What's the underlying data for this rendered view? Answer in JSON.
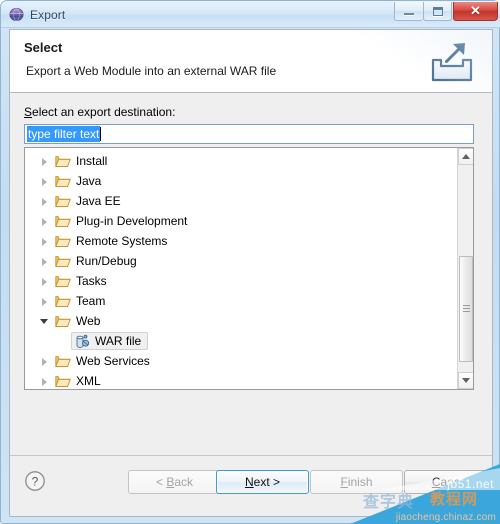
{
  "window": {
    "title": "Export",
    "app_icon": "export-globe-icon",
    "controls": {
      "minimize": "minimize-icon",
      "maximize": "maximize-icon",
      "close": "✕"
    }
  },
  "header": {
    "title": "Select",
    "subtitle": "Export a Web Module into an external WAR file",
    "icon": "export-tray-arrow-icon"
  },
  "body": {
    "field_label_mnemonic": "S",
    "field_label_rest": "elect an export destination:",
    "filter": {
      "value": "type filter text",
      "selected": true
    },
    "tree": [
      {
        "label": "Install",
        "expanded": false,
        "type": "folder",
        "selected": false
      },
      {
        "label": "Java",
        "expanded": false,
        "type": "folder",
        "selected": false
      },
      {
        "label": "Java EE",
        "expanded": false,
        "type": "folder",
        "selected": false
      },
      {
        "label": "Plug-in Development",
        "expanded": false,
        "type": "folder",
        "selected": false
      },
      {
        "label": "Remote Systems",
        "expanded": false,
        "type": "folder",
        "selected": false
      },
      {
        "label": "Run/Debug",
        "expanded": false,
        "type": "folder",
        "selected": false
      },
      {
        "label": "Tasks",
        "expanded": false,
        "type": "folder",
        "selected": false
      },
      {
        "label": "Team",
        "expanded": false,
        "type": "folder",
        "selected": false
      },
      {
        "label": "Web",
        "expanded": true,
        "type": "folder",
        "selected": false
      },
      {
        "label": "WAR file",
        "expanded": null,
        "type": "leaf",
        "selected": true,
        "child": true,
        "icon": "war-file-icon"
      },
      {
        "label": "Web Services",
        "expanded": false,
        "type": "folder",
        "selected": false
      },
      {
        "label": "XML",
        "expanded": false,
        "type": "folder",
        "selected": false
      }
    ]
  },
  "buttons": {
    "help": "?",
    "back": {
      "pre": "< ",
      "mnemonic": "B",
      "post": "ack",
      "enabled": false,
      "default": false
    },
    "next": {
      "pre": "",
      "mnemonic": "N",
      "post": "ext >",
      "enabled": true,
      "default": true
    },
    "finish": {
      "pre": "",
      "mnemonic": "F",
      "post": "inish",
      "enabled": false,
      "default": false
    },
    "cancel": {
      "pre": "",
      "mnemonic": "C",
      "post": "ancel",
      "enabled": true,
      "default": false
    }
  },
  "watermark": {
    "line1": "jb51.net",
    "cn_left": "查字典",
    "cn_right": "教程网",
    "line2": "jiaocheng.chinaz.com"
  },
  "colors": {
    "accent": "#3399ff",
    "default_button_border": "#3c9bd4",
    "close_button": "#d7483f",
    "watermark_blue": "#3aa6dc"
  }
}
